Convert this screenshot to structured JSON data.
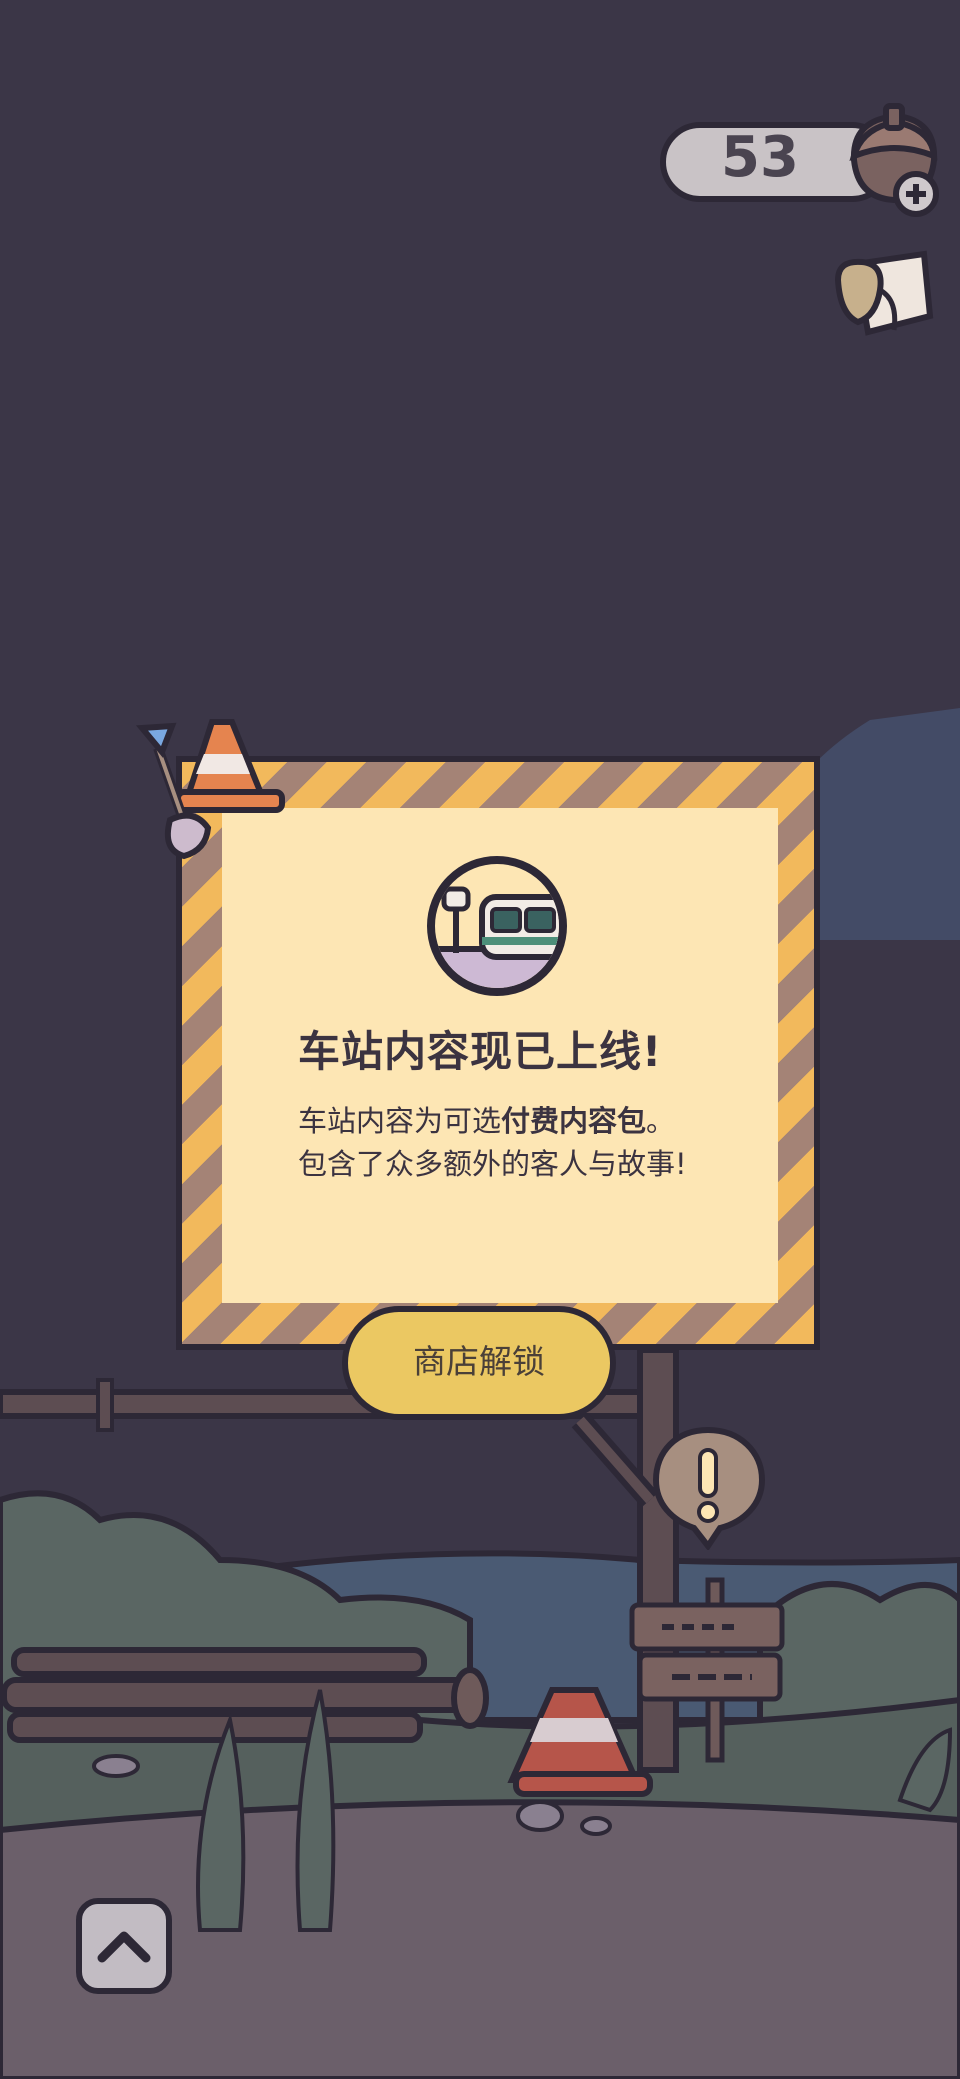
{
  "hud": {
    "currency_value": "53"
  },
  "promo": {
    "title": "车站内容现已上线!",
    "desc_line1_prefix": "车站内容为可选",
    "desc_line1_bold": "付费内容包",
    "desc_line1_suffix": "。",
    "desc_line2": "包含了众多额外的客人与故事!",
    "button_label": "商店解锁"
  },
  "icons": {
    "currency": "acorn-icon",
    "mail": "letter-icon",
    "station": "station-icon",
    "alert": "exclamation-bubble-icon",
    "back": "chevron-up-icon"
  },
  "colors": {
    "night_sky": "#3b3647",
    "stripe_yellow": "#f2b95c",
    "stripe_brown": "#a48376",
    "panel": "#fde6b4",
    "button": "#ebc862",
    "outline": "#2d2836"
  }
}
